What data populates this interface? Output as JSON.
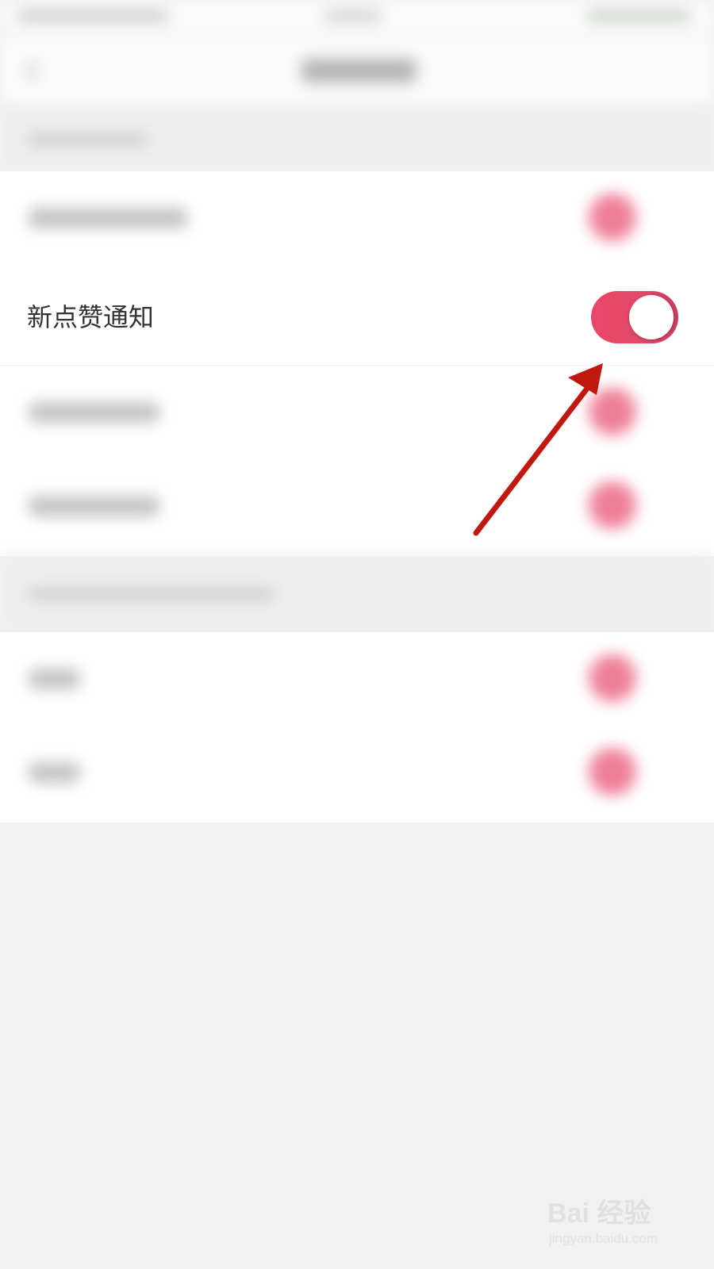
{
  "focused_setting": {
    "label": "新点赞通知",
    "toggle_state": "on",
    "toggle_color": "#e8466a"
  },
  "annotation": {
    "arrow_color": "#c0180e"
  },
  "watermark": {
    "logo": "Bai  经验",
    "url": "jingyan.baidu.com"
  }
}
